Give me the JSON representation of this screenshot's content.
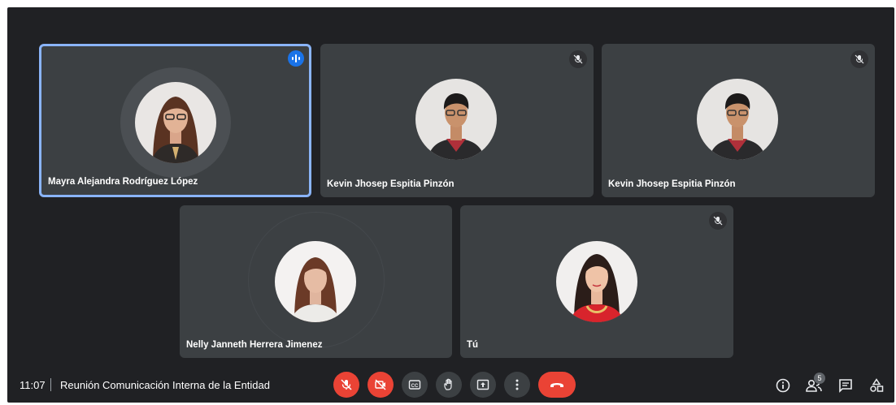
{
  "tiles": [
    {
      "name": "Mayra Alejandra Rodríguez López",
      "state": "speaking",
      "icon": "speaking-indicator-icon"
    },
    {
      "name": "Kevin Jhosep Espitia Pinzón",
      "state": "muted",
      "icon": "mic-off-icon"
    },
    {
      "name": "Kevin Jhosep Espitia Pinzón",
      "state": "muted",
      "icon": "mic-off-icon"
    },
    {
      "name": "Nelly Janneth Herrera Jimenez",
      "state": "unmuted",
      "icon": ""
    },
    {
      "name": "Tú",
      "state": "muted",
      "icon": "mic-off-icon"
    }
  ],
  "bottom_bar": {
    "time": "11:07",
    "meeting_title": "Reunión Comunicación Interna de la Entidad",
    "controls": [
      "mic-off-icon",
      "camera-off-icon",
      "captions-icon",
      "raise-hand-icon",
      "present-icon",
      "more-options-icon",
      "hang-up-icon"
    ],
    "right_icons": [
      "info-icon",
      "people-icon",
      "chat-icon",
      "activities-icon"
    ],
    "participants_count": "5"
  },
  "colors": {
    "background": "#202124",
    "tile": "#3c4043",
    "active_border": "#8ab4f8",
    "accent_red": "#ea4335",
    "speaking_blue": "#1a73e8"
  }
}
